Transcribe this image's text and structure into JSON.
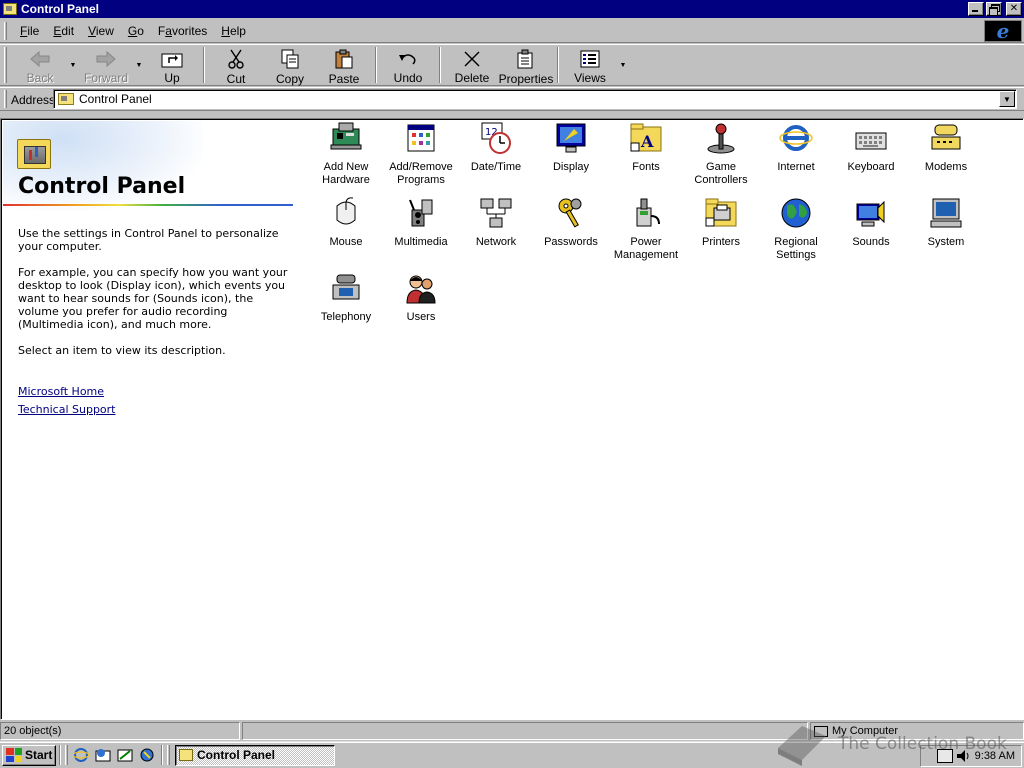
{
  "window": {
    "title": "Control Panel"
  },
  "menu": [
    "File",
    "Edit",
    "View",
    "Go",
    "Favorites",
    "Help"
  ],
  "menu_accel": [
    "F",
    "E",
    "V",
    "G",
    "a",
    "H"
  ],
  "toolbar": {
    "back": "Back",
    "forward": "Forward",
    "up": "Up",
    "cut": "Cut",
    "copy": "Copy",
    "paste": "Paste",
    "undo": "Undo",
    "delete": "Delete",
    "properties": "Properties",
    "views": "Views"
  },
  "address": {
    "label": "Address",
    "value": "Control Panel"
  },
  "webview": {
    "title": "Control Panel",
    "p1": "Use the settings in Control Panel to personalize your computer.",
    "p2": "For example, you can specify how you want your desktop to look (Display icon), which events you want to hear sounds for (Sounds icon), the volume you prefer for audio recording (Multimedia icon), and much more.",
    "p3": "Select an item to view its description.",
    "link1": "Microsoft Home",
    "link2": "Technical Support"
  },
  "items": [
    {
      "label": "Add New Hardware",
      "icon": "add-hardware-icon"
    },
    {
      "label": "Add/Remove Programs",
      "icon": "add-remove-programs-icon"
    },
    {
      "label": "Date/Time",
      "icon": "date-time-icon"
    },
    {
      "label": "Display",
      "icon": "display-icon"
    },
    {
      "label": "Fonts",
      "icon": "fonts-icon"
    },
    {
      "label": "Game Controllers",
      "icon": "joystick-icon"
    },
    {
      "label": "Internet",
      "icon": "internet-icon"
    },
    {
      "label": "Keyboard",
      "icon": "keyboard-icon"
    },
    {
      "label": "Modems",
      "icon": "modem-icon"
    },
    {
      "label": "Mouse",
      "icon": "mouse-icon"
    },
    {
      "label": "Multimedia",
      "icon": "multimedia-icon"
    },
    {
      "label": "Network",
      "icon": "network-icon"
    },
    {
      "label": "Passwords",
      "icon": "keys-icon"
    },
    {
      "label": "Power Management",
      "icon": "power-icon"
    },
    {
      "label": "Printers",
      "icon": "printers-icon"
    },
    {
      "label": "Regional Settings",
      "icon": "globe-icon"
    },
    {
      "label": "Sounds",
      "icon": "sounds-icon"
    },
    {
      "label": "System",
      "icon": "system-icon"
    },
    {
      "label": "Telephony",
      "icon": "telephony-icon"
    },
    {
      "label": "Users",
      "icon": "users-icon"
    }
  ],
  "status": {
    "objects": "20 object(s)",
    "zone": "My Computer"
  },
  "taskbar": {
    "start": "Start",
    "task": "Control Panel",
    "clock": "9:38 AM"
  },
  "watermark": "The Collection Book",
  "colors": {
    "titlebar": "#000080",
    "face": "#c0c0c0",
    "link": "#000080"
  }
}
